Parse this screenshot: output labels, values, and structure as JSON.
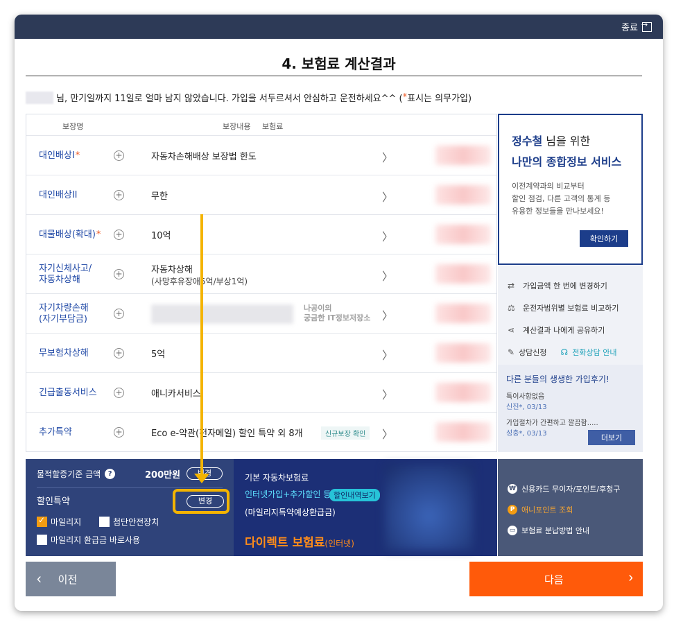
{
  "window": {
    "close_label": "종료"
  },
  "title": "4. 보험료 계산결과",
  "notice": {
    "text": "님, 만기일까지 11일로 얼마 남지 않았습니다. 가입을 서두르셔서 안심하고 운전하세요^^ (",
    "star": "*",
    "tail": " 표시는 의무가입)"
  },
  "table": {
    "headers": {
      "name": "보장명",
      "content": "보장내용",
      "premium": "보험료"
    },
    "rows": [
      {
        "name": "대인배상I",
        "star": "*",
        "detail": "자동차손해배상 보장법 한도",
        "sub": ""
      },
      {
        "name": "대인배상II",
        "star": "",
        "detail": "무한",
        "sub": ""
      },
      {
        "name": "대물배상(확대)",
        "star": "*",
        "detail": "10억",
        "sub": ""
      },
      {
        "name": "자기신체사고/\n자동차상해",
        "star": "",
        "detail": "자동차상해",
        "sub": "(사망후유장애5억/부상1억)"
      },
      {
        "name": "자기차량손해\n(자기부담금)",
        "star": "",
        "detail": "",
        "sub": ""
      },
      {
        "name": "무보험차상해",
        "star": "",
        "detail": "5억",
        "sub": ""
      },
      {
        "name": "긴급출동서비스",
        "star": "",
        "detail": "애니카서비스",
        "sub": ""
      },
      {
        "name": "추가특약",
        "star": "",
        "detail": "Eco e-약관(전자메일) 할인 특약 외 8개",
        "sub": ""
      }
    ],
    "tag_new": "신규보장 확인",
    "watermark": [
      "나공이의",
      "궁금한 IT정보저장소"
    ]
  },
  "side": {
    "promo_name": "정수철",
    "promo_l1_tail": " 님을 위한",
    "promo_l2": "나만의 종합정보 서비스",
    "promo_desc": [
      "이전계약과의 비교부터",
      "할인 점검, 다른 고객의 통계 등",
      "유용한 정보들을 만나보세요!"
    ],
    "confirm_label": "확인하기",
    "links": [
      "가입금액 한 번에 변경하기",
      "운전자범위별 보험료 비교하기",
      "계산결과 나에게 공유하기"
    ],
    "consult": "상담신청",
    "phone": "전화상담 안내",
    "reviews_title": "다른 분들의 생생한 가입후기!",
    "reviews": [
      {
        "text": "특이사항없음",
        "who": "신진*, 03/13"
      },
      {
        "text": "가입절차가 간편하고 깔끔함.....",
        "who": "성충*, 03/13"
      }
    ],
    "more_label": "더보기"
  },
  "bottom_left": {
    "property_label": "물적할증기준 금액",
    "amount": "200만원",
    "change_label": "변경",
    "discount_label": "할인특약",
    "change2_label": "변경",
    "mileage": "마일리지",
    "safety": "첨단안전장치",
    "mileage_refund": "마일리지 환급금 바로사용"
  },
  "bottom_mid": {
    "t1": "기본 자동차보험료",
    "t2": "인터넷가입+추가할인 등",
    "badge": "할인내역보기",
    "t3": "(마일리지특약예상환급금)",
    "t4": "다이렉트 보험료",
    "t4_small": "(인터넷)"
  },
  "bottom_right": {
    "items": [
      "신용카드 무이자/포인트/후청구",
      "애니포인트 조회",
      "보험료 분납방법 안내"
    ]
  },
  "nav": {
    "prev": "이전",
    "next": "다음"
  },
  "colors": {
    "navy": "#2d3a57",
    "accent": "#1c3d8a",
    "orange": "#ff5a0a",
    "highlight": "#f4b400"
  }
}
